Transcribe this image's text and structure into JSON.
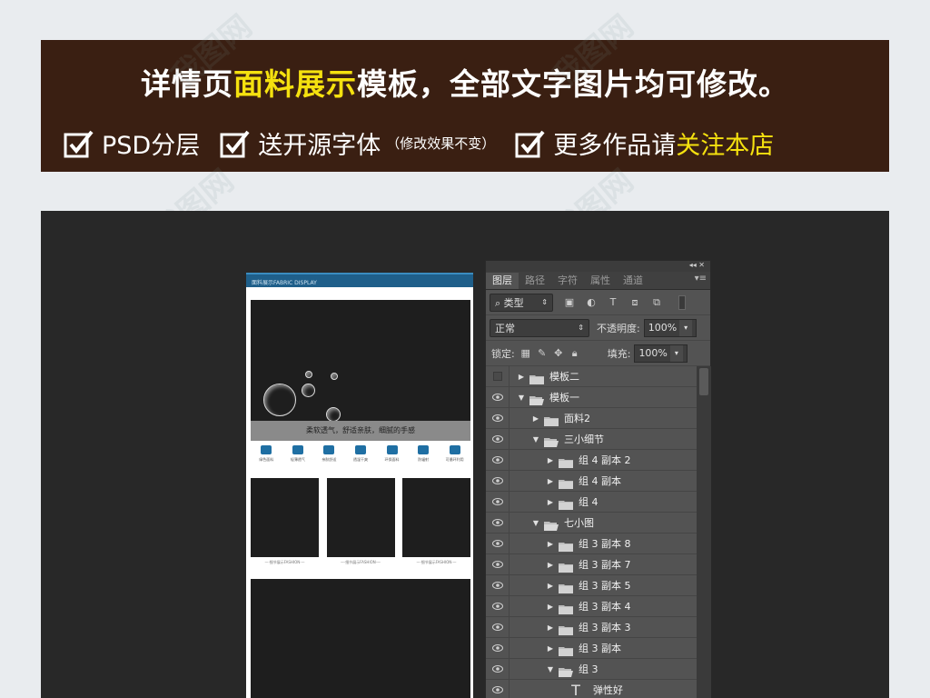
{
  "banner": {
    "title_pre": "详情页",
    "title_highlight": "面料展示",
    "title_post": "模板，全部文字图片均可修改。",
    "features": [
      {
        "text": "PSD分层",
        "small": "",
        "highlight": ""
      },
      {
        "text": "送开源字体",
        "small": "（修改效果不变）",
        "highlight": ""
      },
      {
        "text": "更多作品请",
        "small": "",
        "highlight": "关注本店"
      }
    ]
  },
  "watermark": "我图网",
  "document": {
    "header_text": "面料展示FABRIC DISPLAY",
    "hero_caption": "柔软透气，舒适亲肤，细腻的手感",
    "icons": [
      {
        "icon": "plant-icon",
        "label": "绿色面料"
      },
      {
        "icon": "wind-icon",
        "label": "轻薄透气"
      },
      {
        "icon": "drop-icon",
        "label": "亲肤舒适"
      },
      {
        "icon": "sun-icon",
        "label": "透湿干爽"
      },
      {
        "icon": "leaf-icon",
        "label": "环保面料"
      },
      {
        "icon": "radiation-icon",
        "label": "防辐射"
      },
      {
        "icon": "recycle-icon",
        "label": "可循环利用"
      }
    ],
    "thumbs": [
      "—·细节展示FASHION·—",
      "—·细节展示FASHION·—",
      "—·细节展示FASHION·—"
    ]
  },
  "panel": {
    "tabs": [
      "图层",
      "路径",
      "字符",
      "属性",
      "通道"
    ],
    "filter_label": "类型",
    "blend_mode": "正常",
    "opacity_label": "不透明度:",
    "opacity_value": "100%",
    "lock_label": "锁定:",
    "fill_label": "填充:",
    "fill_value": "100%",
    "layers": [
      {
        "name": "模板二",
        "visible": false,
        "indent": 0,
        "expanded": false,
        "type": "folder"
      },
      {
        "name": "模板一",
        "visible": true,
        "indent": 0,
        "expanded": true,
        "type": "folder"
      },
      {
        "name": "面料2",
        "visible": true,
        "indent": 1,
        "expanded": false,
        "type": "folder"
      },
      {
        "name": "三小细节",
        "visible": true,
        "indent": 1,
        "expanded": true,
        "type": "folder"
      },
      {
        "name": "组 4 副本 2",
        "visible": true,
        "indent": 2,
        "expanded": false,
        "type": "folder"
      },
      {
        "name": "组 4 副本",
        "visible": true,
        "indent": 2,
        "expanded": false,
        "type": "folder"
      },
      {
        "name": "组 4",
        "visible": true,
        "indent": 2,
        "expanded": false,
        "type": "folder"
      },
      {
        "name": "七小图",
        "visible": true,
        "indent": 1,
        "expanded": true,
        "type": "folder"
      },
      {
        "name": "组 3 副本 8",
        "visible": true,
        "indent": 2,
        "expanded": false,
        "type": "folder"
      },
      {
        "name": "组 3 副本 7",
        "visible": true,
        "indent": 2,
        "expanded": false,
        "type": "folder"
      },
      {
        "name": "组 3 副本 5",
        "visible": true,
        "indent": 2,
        "expanded": false,
        "type": "folder"
      },
      {
        "name": "组 3 副本 4",
        "visible": true,
        "indent": 2,
        "expanded": false,
        "type": "folder"
      },
      {
        "name": "组 3 副本 3",
        "visible": true,
        "indent": 2,
        "expanded": false,
        "type": "folder"
      },
      {
        "name": "组 3 副本",
        "visible": true,
        "indent": 2,
        "expanded": false,
        "type": "folder"
      },
      {
        "name": "组 3",
        "visible": true,
        "indent": 2,
        "expanded": true,
        "type": "folder"
      },
      {
        "name": "弹性好",
        "visible": true,
        "indent": 3,
        "expanded": false,
        "type": "text"
      }
    ]
  }
}
